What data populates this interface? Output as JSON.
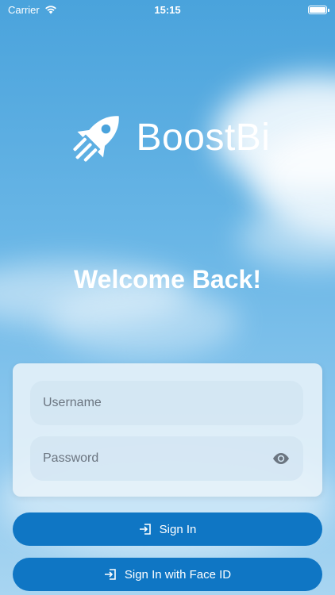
{
  "status_bar": {
    "carrier": "Carrier",
    "time": "15:15"
  },
  "logo": {
    "name": "BoostBi",
    "icon": "rocket-icon"
  },
  "welcome": "Welcome Back!",
  "form": {
    "username_placeholder": "Username",
    "password_placeholder": "Password",
    "password_toggle_icon": "eye-icon"
  },
  "buttons": {
    "sign_in": "Sign In",
    "sign_in_face_id": "Sign In with Face ID",
    "icon": "sign-in-icon"
  },
  "colors": {
    "primary": "#0f76c4",
    "sky": "#5aaee3",
    "text": "#ffffff"
  }
}
